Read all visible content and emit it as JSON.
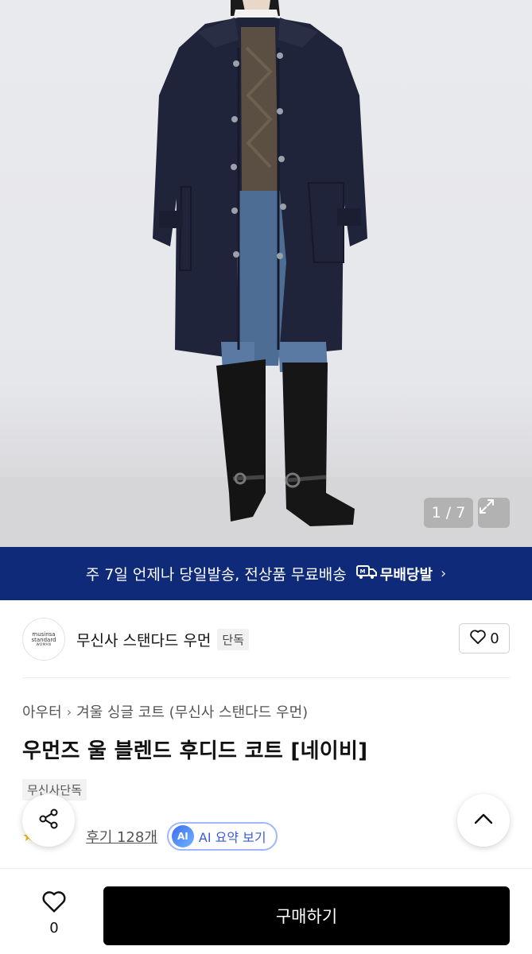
{
  "gallery": {
    "counter": "1 / 7",
    "image_alt": "product photo: model wearing navy hooded wool coat with black knee boots",
    "expand_icon": "expand-icon"
  },
  "banner": {
    "text": "주 7일 언제나 당일발송, 전상품 무료배송",
    "badge_label": "무배당발",
    "badge_icon": "truck-icon"
  },
  "brand": {
    "logo_line1": "musinsa",
    "logo_line2": "standard",
    "logo_line3": "WOMAN",
    "name": "무신사 스탠다드 우먼",
    "tag": "단독",
    "like_count": "0"
  },
  "product": {
    "breadcrumb": [
      "아우터",
      "겨울 싱글 코트 (무신사 스탠다드 우먼)"
    ],
    "title": "우먼즈 울 블렌드 후디드 코트 [네이비]",
    "store_tag": "무신사단독",
    "review_link": "후기 128개",
    "ai_badge": "AI",
    "ai_label": "AI 요약 보기"
  },
  "bottom": {
    "like_count": "0",
    "buy_label": "구매하기"
  },
  "colors": {
    "banner_bg": "#0e2a78",
    "buy_bg": "#000000",
    "star": "#f5b50a",
    "ai_accent": "#3a5bd9"
  }
}
